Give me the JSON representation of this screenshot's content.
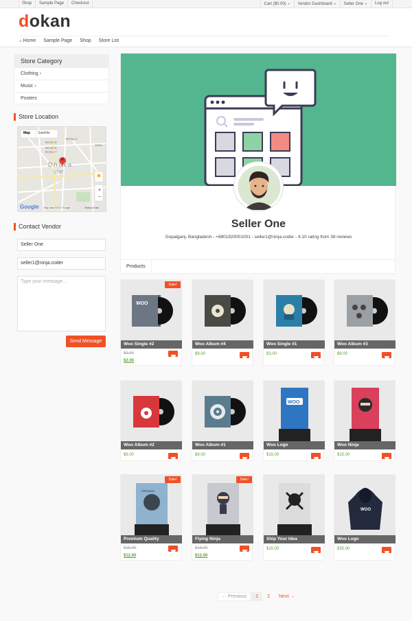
{
  "topbar": {
    "left": [
      "Shop",
      "Sample Page",
      "Checkout"
    ],
    "cart": "Cart ($0.00)",
    "vendor_dashboard": "Vendor Dashboard",
    "user": "Seller One",
    "logout": "Log out"
  },
  "logo": {
    "first": "d",
    "rest": "okan"
  },
  "nav": {
    "home": "Home",
    "sample_page": "Sample Page",
    "shop": "Shop",
    "store_list": "Store List"
  },
  "sidebar": {
    "category_title": "Store Category",
    "categories": [
      {
        "label": "Clothing",
        "arrow": "›"
      },
      {
        "label": "Music",
        "arrow": "›"
      },
      {
        "label": "Posters",
        "arrow": ""
      }
    ],
    "location_title": "Store Location",
    "map": {
      "map_tab": "Map",
      "satellite_tab": "Satellite",
      "streets": [
        "Rd No 9",
        "Rd No 8",
        "Rd No 7",
        "Rd No 4",
        "Jamu"
      ],
      "city": "Dhaka",
      "city_local": "ঢাকা",
      "zoom_in": "+",
      "zoom_out": "−",
      "google": "Google",
      "credit": "Map data ©2017 Google",
      "terms": "Terms of Use"
    },
    "contact_title": "Contact Vendor",
    "contact": {
      "name_value": "Seller One",
      "email_value": "seller1@ninja.coder",
      "message_placeholder": "Type your message...",
      "send_label": "Send Message"
    }
  },
  "store": {
    "name": "Seller One",
    "info": "Gopalganj, Bangladesh - +8801920001001 - seller1@ninja.coder - 4.10 rating from 39 reviews",
    "tab": "Products"
  },
  "products": [
    {
      "name": "Woo Single #2",
      "old_price": "$3.00",
      "price": "$2.00",
      "sale": "Sale!"
    },
    {
      "name": "Woo Album #4",
      "price": "$9.00"
    },
    {
      "name": "Woo Single #1",
      "price": "$3.00"
    },
    {
      "name": "Woo Album #3",
      "price": "$9.00"
    },
    {
      "name": "Woo Album #2",
      "price": "$9.00"
    },
    {
      "name": "Woo Album #1",
      "price": "$9.00"
    },
    {
      "name": "Woo Logo",
      "price": "$15.00"
    },
    {
      "name": "Woo Ninja",
      "price": "$15.00"
    },
    {
      "name": "Premium Quality",
      "old_price": "$15.00",
      "price": "$12.00",
      "sale": "Sale!"
    },
    {
      "name": "Flying Ninja",
      "old_price": "$15.00",
      "price": "$12.00",
      "sale": "Sale!"
    },
    {
      "name": "Ship Your Idea",
      "price": "$15.00"
    },
    {
      "name": "Woo Logo",
      "price": "$35.00"
    }
  ],
  "pagination": {
    "prev": "← Previous",
    "page1": "1",
    "page2": "2",
    "next": "Next →"
  },
  "colors": {
    "accent": "#f05025",
    "banner": "#54b68f",
    "price": "#5a9e35"
  }
}
